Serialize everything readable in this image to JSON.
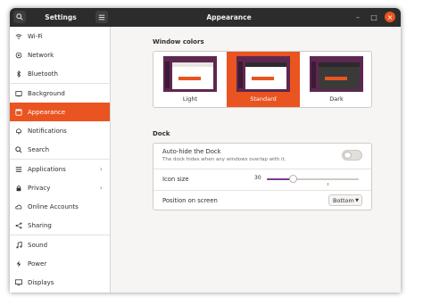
{
  "header": {
    "app_title": "Settings",
    "page_title": "Appearance",
    "search_icon": "search-icon",
    "menu_icon": "hamburger-menu-icon",
    "window_controls": {
      "minimize": "–",
      "maximize": "□",
      "close": "×"
    }
  },
  "sidebar": {
    "items": [
      {
        "label": "Wi-Fi",
        "icon": "wifi-icon"
      },
      {
        "label": "Network",
        "icon": "network-icon"
      },
      {
        "label": "Bluetooth",
        "icon": "bluetooth-icon"
      },
      {
        "label": "Background",
        "icon": "background-icon"
      },
      {
        "label": "Appearance",
        "icon": "appearance-icon",
        "active": true
      },
      {
        "label": "Notifications",
        "icon": "bell-icon"
      },
      {
        "label": "Search",
        "icon": "search-icon"
      },
      {
        "label": "Applications",
        "icon": "apps-icon",
        "chevron": "›"
      },
      {
        "label": "Privacy",
        "icon": "lock-icon",
        "chevron": "›"
      },
      {
        "label": "Online Accounts",
        "icon": "cloud-icon"
      },
      {
        "label": "Sharing",
        "icon": "share-icon"
      },
      {
        "label": "Sound",
        "icon": "music-note-icon"
      },
      {
        "label": "Power",
        "icon": "power-icon"
      },
      {
        "label": "Displays",
        "icon": "display-icon"
      }
    ]
  },
  "window_colors": {
    "section_label": "Window colors",
    "options": [
      {
        "label": "Light",
        "selected": false
      },
      {
        "label": "Standard",
        "selected": true
      },
      {
        "label": "Dark",
        "selected": false
      }
    ]
  },
  "dock": {
    "section_label": "Dock",
    "autohide": {
      "label": "Auto-hide the Dock",
      "description": "The dock hides when any windows overlap with it.",
      "enabled": false
    },
    "icon_size": {
      "label": "Icon size",
      "value": "30",
      "min": 16,
      "max": 64,
      "current": 30
    },
    "position": {
      "label": "Position on screen",
      "value": "Bottom"
    }
  },
  "colors": {
    "accent": "#e95420",
    "slider": "#7e3a8f",
    "header": "#2c2c2c"
  }
}
